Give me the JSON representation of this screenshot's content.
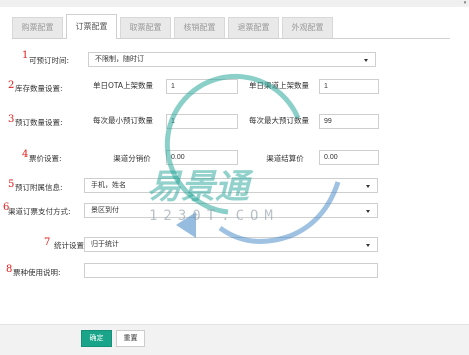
{
  "tabs": [
    "购票配置",
    "订票配置",
    "取票配置",
    "核销配置",
    "退票配置",
    "外观配置"
  ],
  "active_tab_index": 1,
  "rows": {
    "r1": {
      "num": "1",
      "label": "可预订时间:",
      "select_value": "不限制，随时订"
    },
    "r2": {
      "num": "2",
      "label": "库存数量设置:",
      "left_label": "单日OTA上架数量",
      "left_value": "1",
      "right_label": "单日渠道上架数量",
      "right_value": "1"
    },
    "r3": {
      "num": "3",
      "label": "预订数量设置:",
      "left_label": "每次最小预订数量",
      "left_value": "1",
      "right_label": "每次最大预订数量",
      "right_value": "99"
    },
    "r4": {
      "num": "4",
      "label": "票价设置:",
      "left_label": "渠道分销价",
      "left_value": "0.00",
      "right_label": "渠道结算价",
      "right_value": "0.00"
    },
    "r5": {
      "num": "5",
      "label": "预订附属信息:",
      "select_value": "手机，姓名"
    },
    "r6": {
      "num": "6",
      "label": "渠道订票支付方式:",
      "select_value": "景区到付"
    },
    "r7": {
      "num": "7",
      "label": "统计设置:",
      "select_value": "归于统计"
    },
    "r8": {
      "num": "8",
      "label": "票种使用说明:",
      "input_value": ""
    }
  },
  "buttons": {
    "ok": "确定",
    "reset": "重置"
  },
  "watermark": {
    "brand": "易景通",
    "url": "1230T.COM"
  },
  "colors": {
    "marker": "#e21a1a",
    "primary_button": "#1aa58b",
    "watermark_teal": "#2aa79a",
    "watermark_blue": "#3f86c5"
  },
  "icons": {
    "select_caret": "caret-down-icon",
    "scroll_hint": "chevron-down-icon"
  }
}
